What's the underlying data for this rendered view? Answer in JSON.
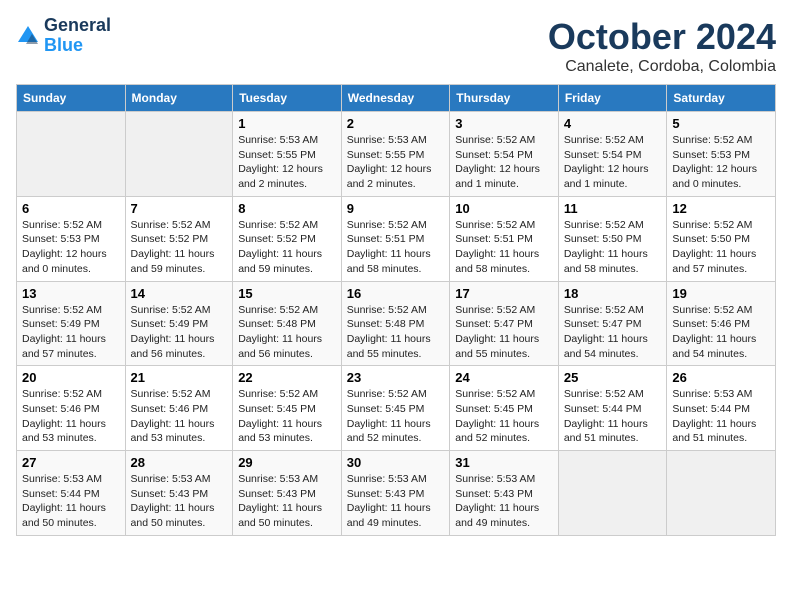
{
  "header": {
    "logo_line1": "General",
    "logo_line2": "Blue",
    "month": "October 2024",
    "location": "Canalete, Cordoba, Colombia"
  },
  "days_of_week": [
    "Sunday",
    "Monday",
    "Tuesday",
    "Wednesday",
    "Thursday",
    "Friday",
    "Saturday"
  ],
  "weeks": [
    [
      {
        "day": "",
        "info": ""
      },
      {
        "day": "",
        "info": ""
      },
      {
        "day": "1",
        "info": "Sunrise: 5:53 AM\nSunset: 5:55 PM\nDaylight: 12 hours\nand 2 minutes."
      },
      {
        "day": "2",
        "info": "Sunrise: 5:53 AM\nSunset: 5:55 PM\nDaylight: 12 hours\nand 2 minutes."
      },
      {
        "day": "3",
        "info": "Sunrise: 5:52 AM\nSunset: 5:54 PM\nDaylight: 12 hours\nand 1 minute."
      },
      {
        "day": "4",
        "info": "Sunrise: 5:52 AM\nSunset: 5:54 PM\nDaylight: 12 hours\nand 1 minute."
      },
      {
        "day": "5",
        "info": "Sunrise: 5:52 AM\nSunset: 5:53 PM\nDaylight: 12 hours\nand 0 minutes."
      }
    ],
    [
      {
        "day": "6",
        "info": "Sunrise: 5:52 AM\nSunset: 5:53 PM\nDaylight: 12 hours\nand 0 minutes."
      },
      {
        "day": "7",
        "info": "Sunrise: 5:52 AM\nSunset: 5:52 PM\nDaylight: 11 hours\nand 59 minutes."
      },
      {
        "day": "8",
        "info": "Sunrise: 5:52 AM\nSunset: 5:52 PM\nDaylight: 11 hours\nand 59 minutes."
      },
      {
        "day": "9",
        "info": "Sunrise: 5:52 AM\nSunset: 5:51 PM\nDaylight: 11 hours\nand 58 minutes."
      },
      {
        "day": "10",
        "info": "Sunrise: 5:52 AM\nSunset: 5:51 PM\nDaylight: 11 hours\nand 58 minutes."
      },
      {
        "day": "11",
        "info": "Sunrise: 5:52 AM\nSunset: 5:50 PM\nDaylight: 11 hours\nand 58 minutes."
      },
      {
        "day": "12",
        "info": "Sunrise: 5:52 AM\nSunset: 5:50 PM\nDaylight: 11 hours\nand 57 minutes."
      }
    ],
    [
      {
        "day": "13",
        "info": "Sunrise: 5:52 AM\nSunset: 5:49 PM\nDaylight: 11 hours\nand 57 minutes."
      },
      {
        "day": "14",
        "info": "Sunrise: 5:52 AM\nSunset: 5:49 PM\nDaylight: 11 hours\nand 56 minutes."
      },
      {
        "day": "15",
        "info": "Sunrise: 5:52 AM\nSunset: 5:48 PM\nDaylight: 11 hours\nand 56 minutes."
      },
      {
        "day": "16",
        "info": "Sunrise: 5:52 AM\nSunset: 5:48 PM\nDaylight: 11 hours\nand 55 minutes."
      },
      {
        "day": "17",
        "info": "Sunrise: 5:52 AM\nSunset: 5:47 PM\nDaylight: 11 hours\nand 55 minutes."
      },
      {
        "day": "18",
        "info": "Sunrise: 5:52 AM\nSunset: 5:47 PM\nDaylight: 11 hours\nand 54 minutes."
      },
      {
        "day": "19",
        "info": "Sunrise: 5:52 AM\nSunset: 5:46 PM\nDaylight: 11 hours\nand 54 minutes."
      }
    ],
    [
      {
        "day": "20",
        "info": "Sunrise: 5:52 AM\nSunset: 5:46 PM\nDaylight: 11 hours\nand 53 minutes."
      },
      {
        "day": "21",
        "info": "Sunrise: 5:52 AM\nSunset: 5:46 PM\nDaylight: 11 hours\nand 53 minutes."
      },
      {
        "day": "22",
        "info": "Sunrise: 5:52 AM\nSunset: 5:45 PM\nDaylight: 11 hours\nand 53 minutes."
      },
      {
        "day": "23",
        "info": "Sunrise: 5:52 AM\nSunset: 5:45 PM\nDaylight: 11 hours\nand 52 minutes."
      },
      {
        "day": "24",
        "info": "Sunrise: 5:52 AM\nSunset: 5:45 PM\nDaylight: 11 hours\nand 52 minutes."
      },
      {
        "day": "25",
        "info": "Sunrise: 5:52 AM\nSunset: 5:44 PM\nDaylight: 11 hours\nand 51 minutes."
      },
      {
        "day": "26",
        "info": "Sunrise: 5:53 AM\nSunset: 5:44 PM\nDaylight: 11 hours\nand 51 minutes."
      }
    ],
    [
      {
        "day": "27",
        "info": "Sunrise: 5:53 AM\nSunset: 5:44 PM\nDaylight: 11 hours\nand 50 minutes."
      },
      {
        "day": "28",
        "info": "Sunrise: 5:53 AM\nSunset: 5:43 PM\nDaylight: 11 hours\nand 50 minutes."
      },
      {
        "day": "29",
        "info": "Sunrise: 5:53 AM\nSunset: 5:43 PM\nDaylight: 11 hours\nand 50 minutes."
      },
      {
        "day": "30",
        "info": "Sunrise: 5:53 AM\nSunset: 5:43 PM\nDaylight: 11 hours\nand 49 minutes."
      },
      {
        "day": "31",
        "info": "Sunrise: 5:53 AM\nSunset: 5:43 PM\nDaylight: 11 hours\nand 49 minutes."
      },
      {
        "day": "",
        "info": ""
      },
      {
        "day": "",
        "info": ""
      }
    ]
  ]
}
